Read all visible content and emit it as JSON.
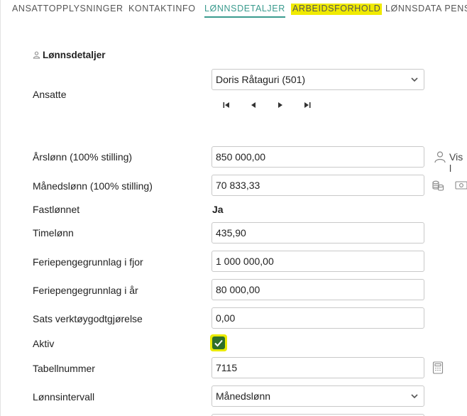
{
  "tabs": [
    {
      "label": "ANSATTOPPLYSNINGER"
    },
    {
      "label": "KONTAKTINFO"
    },
    {
      "label": "LØNNSDETALJER"
    },
    {
      "label": "ARBEIDSFORHOLD"
    },
    {
      "label": "LØNNSDATA PENS"
    }
  ],
  "section": {
    "title": "Lønnsdetaljer",
    "icon": "person-icon"
  },
  "employee": {
    "label": "Ansatte",
    "value": "Doris Råtaguri  (501)"
  },
  "nav_icons": [
    "first-icon",
    "prev-icon",
    "next-icon",
    "last-icon"
  ],
  "fields": {
    "annual_salary": {
      "label": "Årslønn (100% stilling)",
      "value": "850 000,00"
    },
    "monthly_salary": {
      "label": "Månedslønn (100% stilling)",
      "value": "70 833,33"
    },
    "fixed_salary": {
      "label": "Fastlønnet",
      "value": "Ja"
    },
    "hourly_wage": {
      "label": "Timelønn",
      "value": "435,90"
    },
    "holiday_base_last": {
      "label": "Feriepengegrunnlag i fjor",
      "value": "1 000 000,00"
    },
    "holiday_base_this": {
      "label": "Feriepengegrunnlag i år",
      "value": "80 000,00"
    },
    "tool_allowance": {
      "label": "Sats verktøygodtgjørelse",
      "value": "0,00"
    },
    "active": {
      "label": "Aktiv",
      "checked": true
    },
    "table_number": {
      "label": "Tabellnummer",
      "value": "7115"
    },
    "pay_interval": {
      "label": "Lønnsintervall",
      "value": "Månedslønn"
    }
  },
  "side": {
    "show_text": "Vis l"
  },
  "colors": {
    "accent": "#3a9b8e",
    "highlight": "#f0ea00",
    "check_green": "#2e6f2a"
  }
}
